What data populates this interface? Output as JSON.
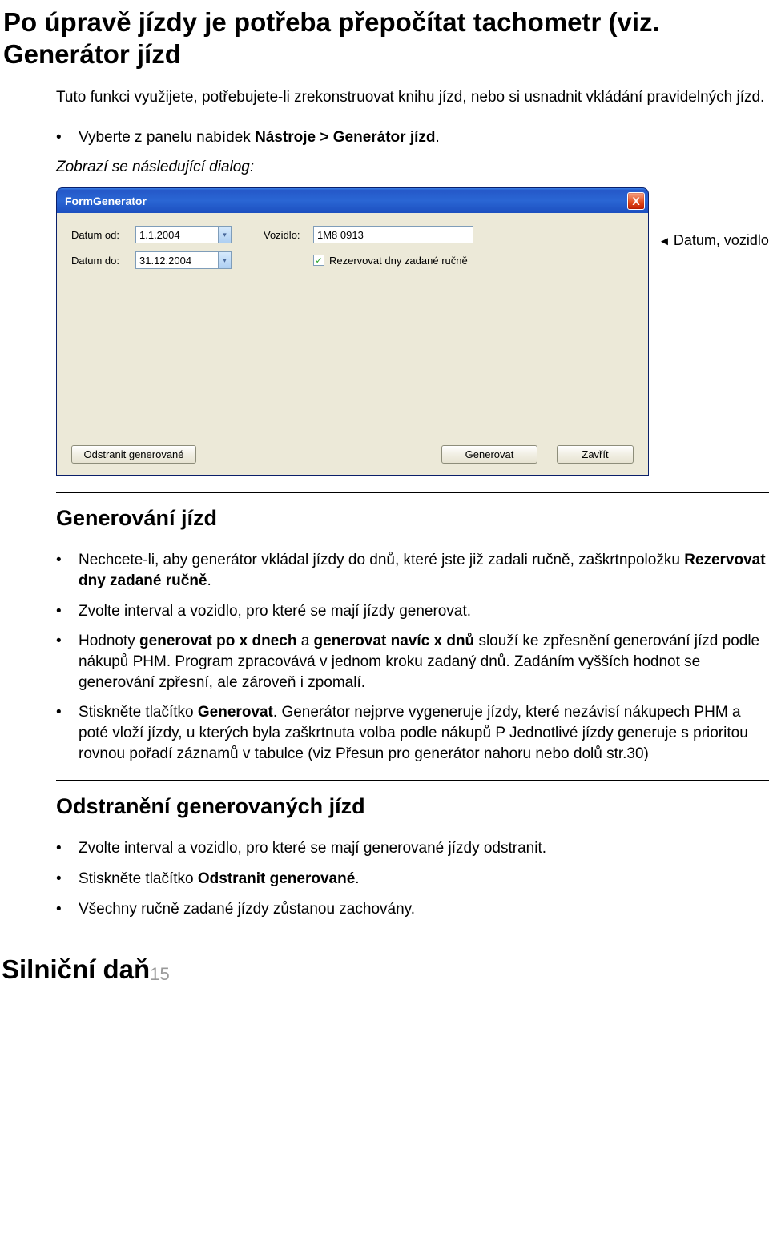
{
  "title": "Po úpravě jízdy je potřeba přepočítat tachometr (viz. Generátor jízd",
  "intro": "Tuto funkci využijete, potřebujete-li zrekonstruovat knihu jízd, nebo si usnadnit vkládání pravidelných jízd.",
  "bullet_top": {
    "pre": "Vyberte z panelu nabídek ",
    "bold": "Nástroje > Generátor jízd",
    "post": "."
  },
  "italic_line": "Zobrazí se následující dialog:",
  "dialog": {
    "title": "FormGenerator",
    "close": "X",
    "datum_od_lbl": "Datum od:",
    "datum_od_val": "1.1.2004",
    "datum_do_lbl": "Datum do:",
    "datum_do_val": "31.12.2004",
    "vozidlo_lbl": "Vozidlo:",
    "vozidlo_val": "1M8 0913",
    "check_mark": "✓",
    "check_lbl": "Rezervovat dny zadané ručně",
    "btn_odstranit": "Odstranit generované",
    "btn_generovat": "Generovat",
    "btn_zavrit": "Zavřít"
  },
  "annotation": "Datum, vozidlo",
  "annotation_tri": "◄",
  "sec1_title": "Generování jízd",
  "sec1_bullets": [
    {
      "parts": [
        {
          "t": "Nechcete-li, aby generátor vkládal jízdy do dnů, které jste již zadali ručně, zaškrtn"
        },
        {
          "t": "položku "
        },
        {
          "b": "Rezervovat dny zadané ručně"
        },
        {
          "t": "."
        }
      ]
    },
    {
      "parts": [
        {
          "t": "Zvolte interval a vozidlo, pro které se mají jízdy generovat."
        }
      ]
    },
    {
      "parts": [
        {
          "t": "Hodnoty "
        },
        {
          "b": "generovat po x dnech"
        },
        {
          "t": " a "
        },
        {
          "b": "generovat navíc x dnů"
        },
        {
          "t": " slouží ke zpřesnění generování jízd podle nákupů PHM. Program zpracovává v jednom kroku zadaný dnů. Zadáním vyšších hodnot se generování zpřesní, ale zároveň i zpomalí."
        }
      ]
    },
    {
      "parts": [
        {
          "t": "Stiskněte tlačítko "
        },
        {
          "b": "Generovat"
        },
        {
          "t": ". Generátor nejprve vygeneruje jízdy, které nezávisí nákupech PHM a poté vloží jízdy, u kterých byla zaškrtnuta volba podle nákupů P Jednotlivé jízdy generuje s prioritou rovnou pořadí záznamů v tabulce (viz Přesun pro generátor nahoru nebo dolů str.30)"
        }
      ]
    }
  ],
  "sec2_title": "Odstranění generovaných jízd",
  "sec2_bullets": [
    {
      "parts": [
        {
          "t": "Zvolte interval a vozidlo, pro které se mají generované jízdy odstranit."
        }
      ]
    },
    {
      "parts": [
        {
          "t": "Stiskněte tlačítko "
        },
        {
          "b": "Odstranit generované"
        },
        {
          "t": "."
        }
      ]
    },
    {
      "parts": [
        {
          "t": "Všechny ručně zadané jízdy zůstanou zachovány."
        }
      ]
    }
  ],
  "bottom_title": "Silniční daň",
  "page_num": "15"
}
